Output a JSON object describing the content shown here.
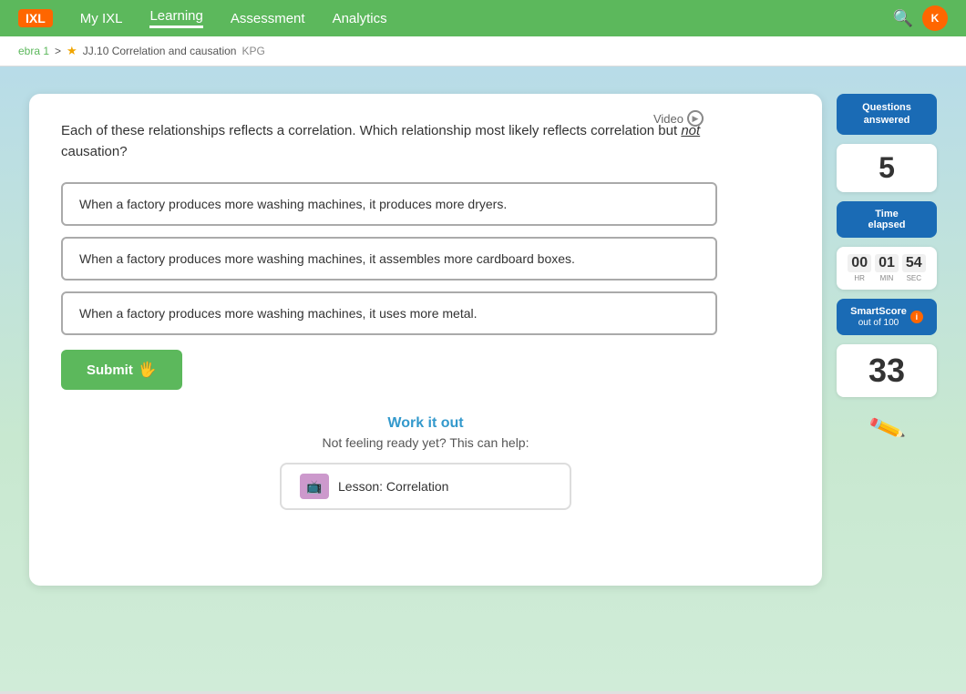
{
  "nav": {
    "logo": "IXL",
    "links": [
      "My IXL",
      "Learning",
      "Assessment",
      "Analytics"
    ],
    "active_link": "Learning"
  },
  "breadcrumb": {
    "course": "ebra 1",
    "separator": ">",
    "lesson_code": "JJ.10 Correlation and causation",
    "tag": "KPG"
  },
  "video": {
    "label": "Video"
  },
  "question": {
    "text_part1": "Each of these relationships reflects a correlation. Which relationship most likely reflects correlation but ",
    "text_italic": "not",
    "text_part2": " causation?"
  },
  "answers": [
    {
      "id": "a",
      "text": "When a factory produces more washing machines, it produces more dryers."
    },
    {
      "id": "b",
      "text": "When a factory produces more washing machines, it assembles more cardboard boxes."
    },
    {
      "id": "c",
      "text": "When a factory produces more washing machines, it uses more metal."
    }
  ],
  "submit_button": {
    "label": "Submit"
  },
  "work_it_out": {
    "title": "Work it out",
    "subtitle": "Not feeling ready yet? This can help:"
  },
  "lesson_link": {
    "label": "Lesson: Correlation"
  },
  "sidebar": {
    "questions_answered_label": "Questions\nanswered",
    "questions_count": "5",
    "time_elapsed_label": "Time\nelapsed",
    "time_hr": "00",
    "time_min": "01",
    "time_sec": "54",
    "time_hr_label": "HR",
    "time_min_label": "MIN",
    "time_sec_label": "SEC",
    "smartscore_label": "SmartScore",
    "smartscore_sublabel": "out of 100",
    "score": "33"
  }
}
